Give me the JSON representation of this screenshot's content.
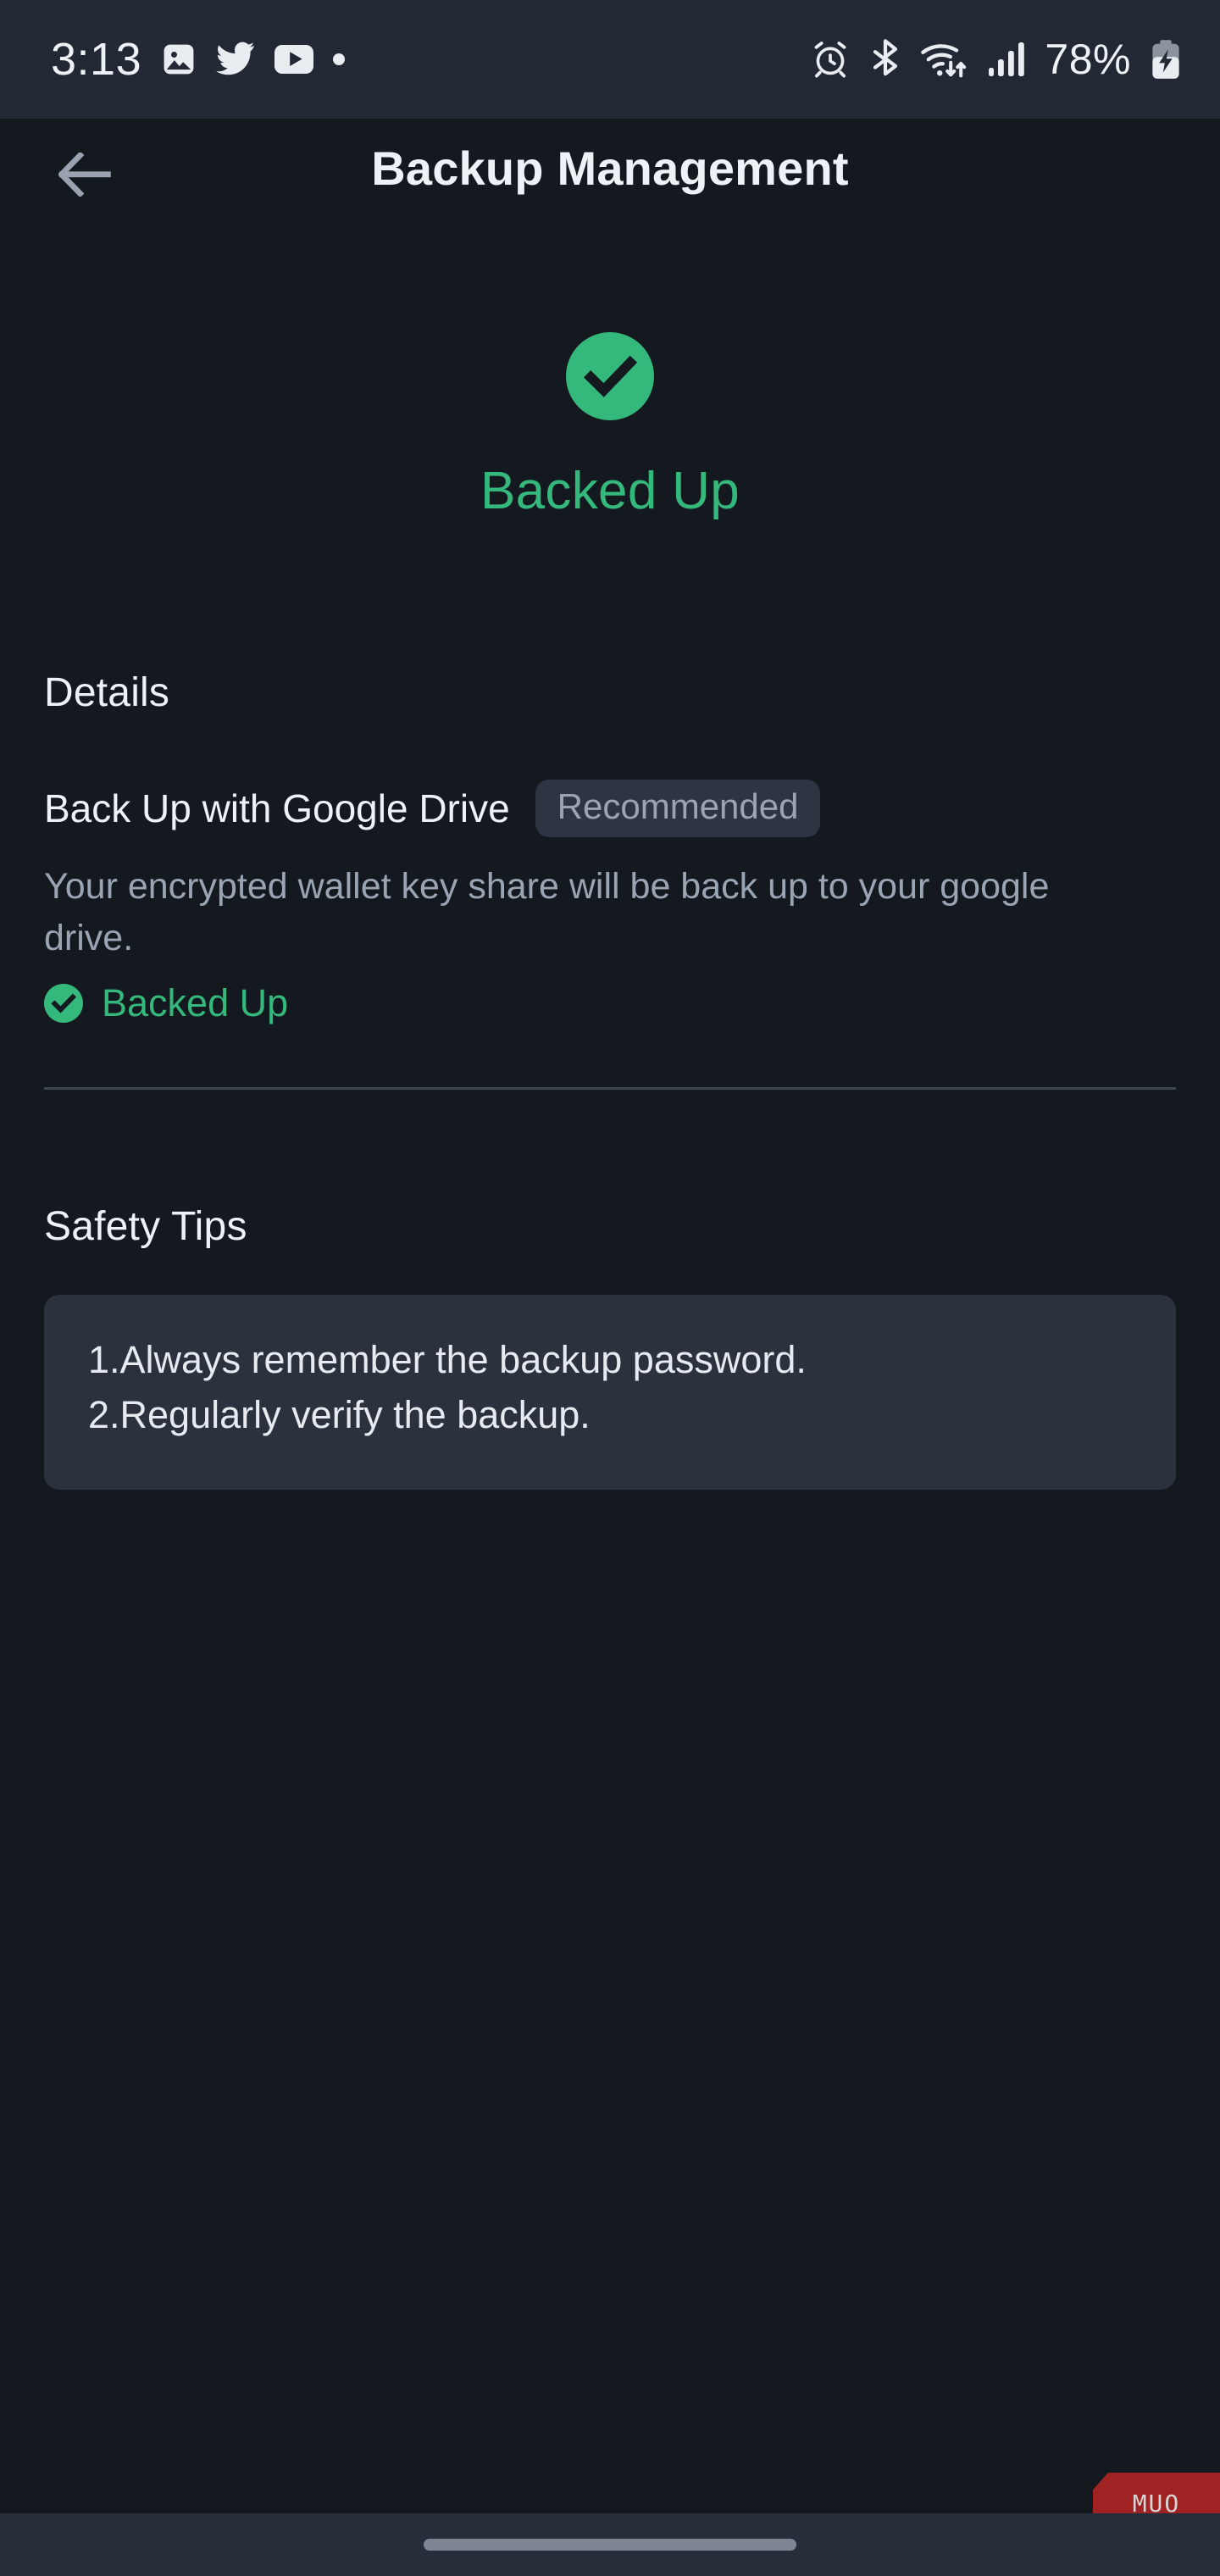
{
  "status_bar": {
    "time": "3:13",
    "left_icons": [
      "photos-icon",
      "twitter-icon",
      "youtube-icon",
      "dot-indicator-icon"
    ],
    "right_icons": [
      "alarm-icon",
      "bluetooth-icon",
      "wifi-icon",
      "cellular-signal-icon"
    ],
    "battery_percent": "78%",
    "battery_icon": "battery-charging-icon",
    "background_color": "#222834"
  },
  "app_bar": {
    "back_icon": "arrow-left-icon",
    "title": "Backup Management"
  },
  "hero": {
    "icon": "check-circle-icon",
    "label": "Backed Up",
    "accent_color": "#34b87c"
  },
  "details": {
    "heading": "Details",
    "row": {
      "title": "Back Up with Google Drive",
      "badge": "Recommended",
      "description": "Your encrypted wallet key share will be back up to your google drive.",
      "status_icon": "check-circle-icon",
      "status_label": "Backed Up"
    }
  },
  "safety_tips": {
    "heading": "Safety Tips",
    "tips": [
      "1.Always remember the backup password.",
      "2.Regularly verify the backup."
    ],
    "card_color": "#2b323e"
  },
  "watermark": {
    "label": "MUO",
    "color": "#a02222"
  },
  "nav_bar": {
    "gesture_handle": "home-gesture-pill"
  }
}
